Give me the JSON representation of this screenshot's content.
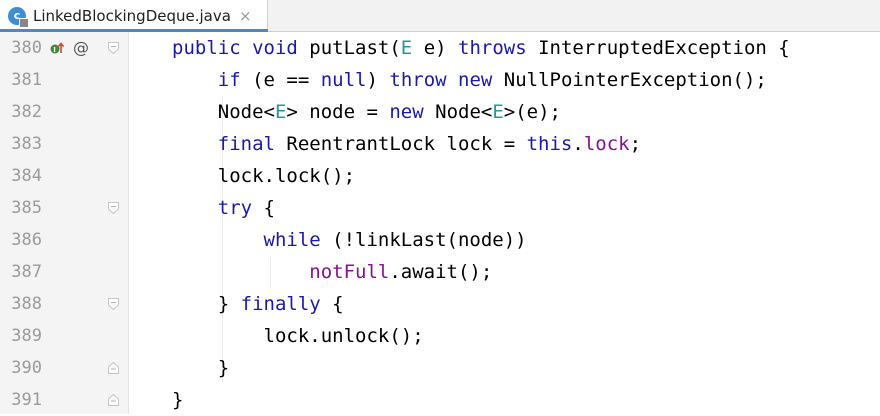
{
  "tab": {
    "icon_letter": "c",
    "title": "LinkedBlockingDeque.java",
    "close": "×"
  },
  "gutter": {
    "annotation_marker": "@"
  },
  "lines": [
    {
      "num": "380",
      "tokens": [
        {
          "t": "public ",
          "c": "kw"
        },
        {
          "t": "void ",
          "c": "kw"
        },
        {
          "t": "putLast(",
          "c": ""
        },
        {
          "t": "E",
          "c": "tp"
        },
        {
          "t": " e) ",
          "c": ""
        },
        {
          "t": "throws ",
          "c": "kw"
        },
        {
          "t": "InterruptedException {",
          "c": ""
        }
      ]
    },
    {
      "num": "381",
      "tokens": [
        {
          "t": "    if ",
          "c": "kw"
        },
        {
          "t": "(e == ",
          "c": ""
        },
        {
          "t": "null",
          "c": "kw"
        },
        {
          "t": ") ",
          "c": ""
        },
        {
          "t": "throw new ",
          "c": "kw"
        },
        {
          "t": "NullPointerException();",
          "c": ""
        }
      ]
    },
    {
      "num": "382",
      "tokens": [
        {
          "t": "    Node<",
          "c": ""
        },
        {
          "t": "E",
          "c": "tp"
        },
        {
          "t": "> node = ",
          "c": ""
        },
        {
          "t": "new ",
          "c": "kw"
        },
        {
          "t": "Node<",
          "c": ""
        },
        {
          "t": "E",
          "c": "tp"
        },
        {
          "t": ">(e);",
          "c": ""
        }
      ]
    },
    {
      "num": "383",
      "tokens": [
        {
          "t": "    final ",
          "c": "kw"
        },
        {
          "t": "ReentrantLock lock = ",
          "c": ""
        },
        {
          "t": "this",
          "c": "kw"
        },
        {
          "t": ".",
          "c": ""
        },
        {
          "t": "lock",
          "c": "fld"
        },
        {
          "t": ";",
          "c": ""
        }
      ]
    },
    {
      "num": "384",
      "tokens": [
        {
          "t": "    lock.lock();",
          "c": ""
        }
      ]
    },
    {
      "num": "385",
      "tokens": [
        {
          "t": "    try ",
          "c": "kw"
        },
        {
          "t": "{",
          "c": ""
        }
      ]
    },
    {
      "num": "386",
      "tokens": [
        {
          "t": "        while ",
          "c": "kw"
        },
        {
          "t": "(!linkLast(node))",
          "c": ""
        }
      ]
    },
    {
      "num": "387",
      "tokens": [
        {
          "t": "            ",
          "c": ""
        },
        {
          "t": "notFull",
          "c": "fld"
        },
        {
          "t": ".await();",
          "c": ""
        }
      ]
    },
    {
      "num": "388",
      "tokens": [
        {
          "t": "    } ",
          "c": ""
        },
        {
          "t": "finally ",
          "c": "kw"
        },
        {
          "t": "{",
          "c": ""
        }
      ]
    },
    {
      "num": "389",
      "tokens": [
        {
          "t": "        lock.unlock();",
          "c": ""
        }
      ]
    },
    {
      "num": "390",
      "tokens": [
        {
          "t": "    }",
          "c": ""
        }
      ]
    },
    {
      "num": "391",
      "tokens": [
        {
          "t": "}",
          "c": ""
        }
      ]
    }
  ],
  "colors": {
    "keyword": "#1a1aa6",
    "field": "#871094",
    "type_param": "#20999d",
    "line_number": "#9a9a9a",
    "tab_accent": "#4a88c7"
  }
}
